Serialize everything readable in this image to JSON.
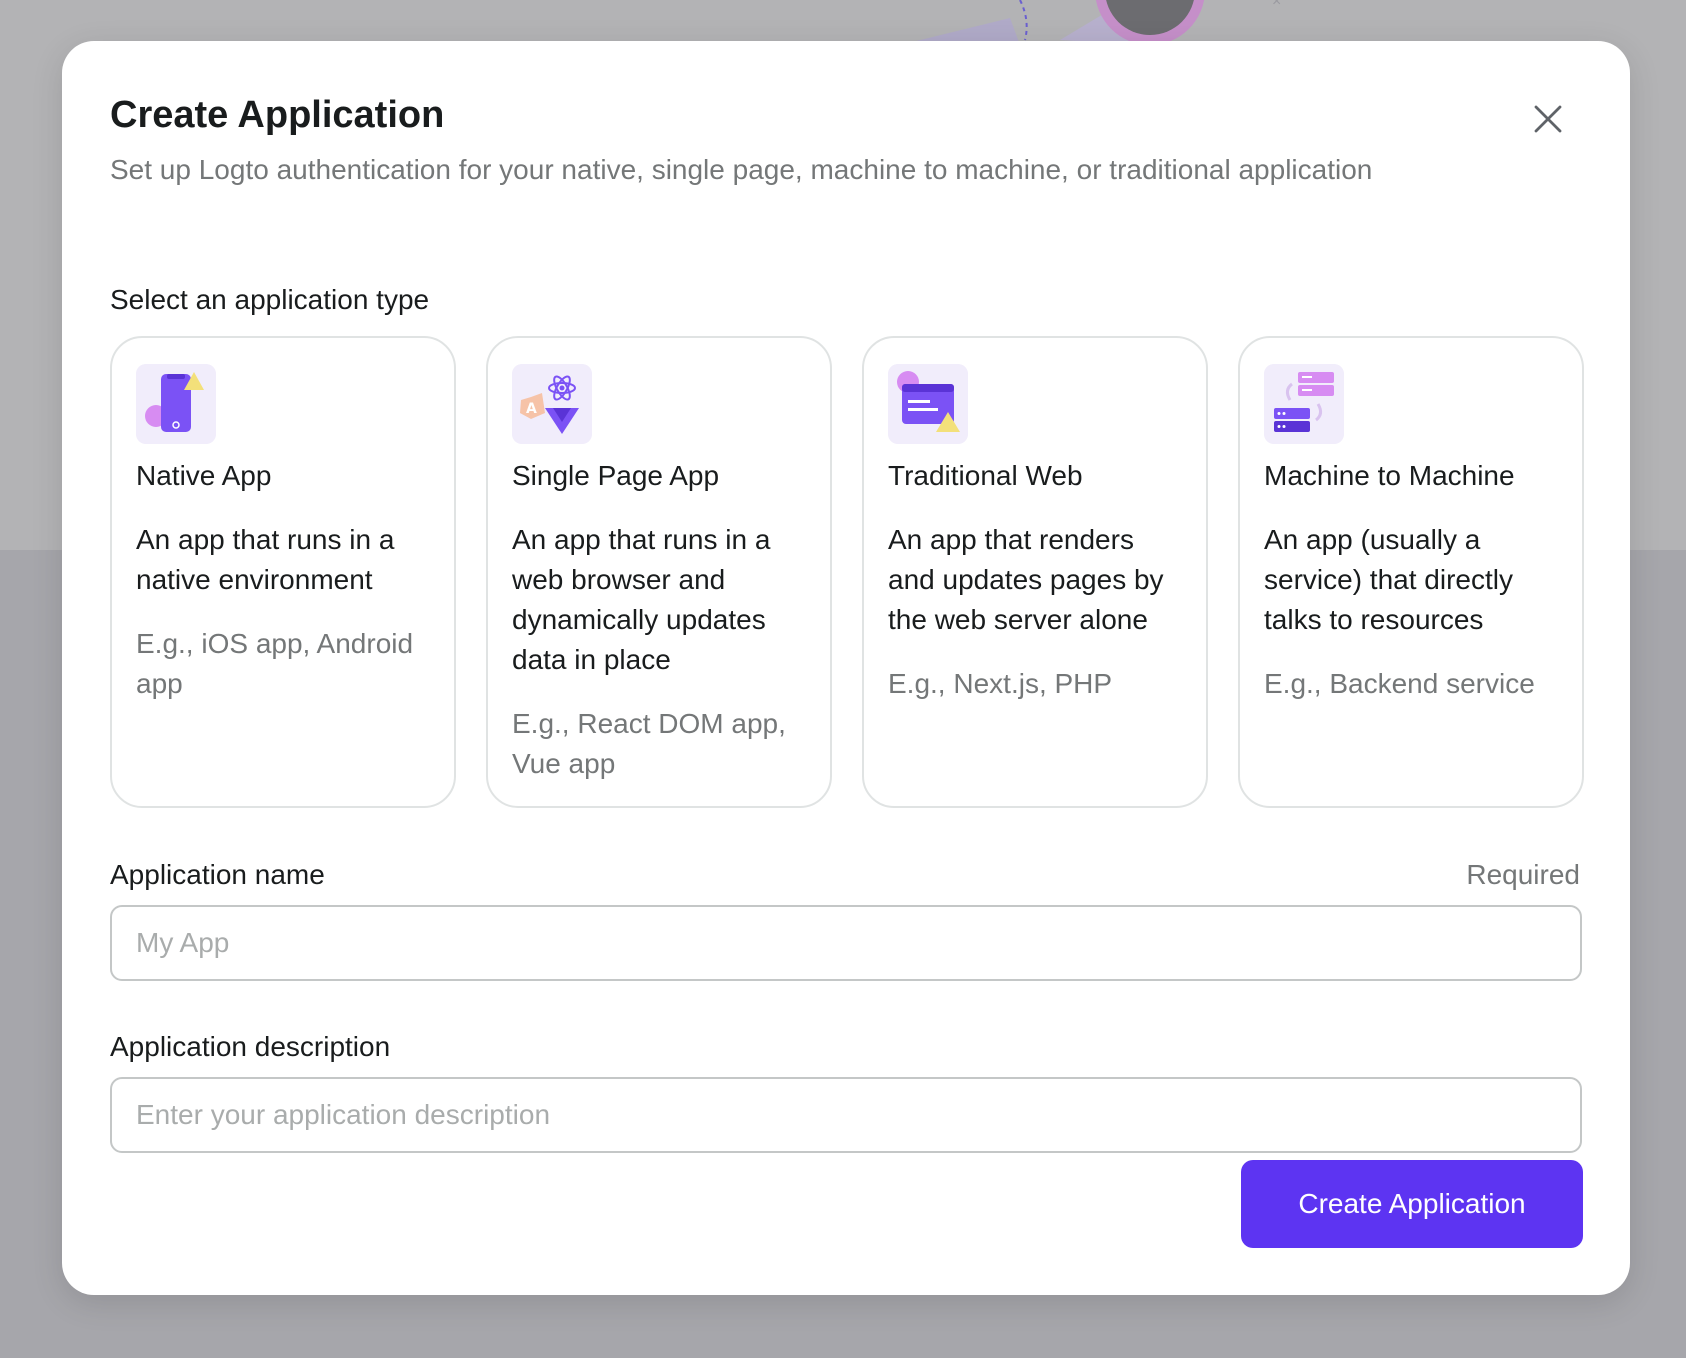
{
  "modal": {
    "title": "Create Application",
    "subtitle": "Set up Logto authentication for your native, single page, machine to machine, or traditional application",
    "close_icon": "close-icon"
  },
  "app_type": {
    "label": "Select an application type",
    "cards": [
      {
        "icon": "native-app-icon",
        "title": "Native App",
        "description": "An app that runs in a native environment",
        "example": "E.g., iOS app, Android app"
      },
      {
        "icon": "single-page-app-icon",
        "title": "Single Page App",
        "description": "An app that runs in a web browser and dynamically updates data in place",
        "example": "E.g., React DOM app, Vue app"
      },
      {
        "icon": "traditional-web-icon",
        "title": "Traditional Web",
        "description": "An app that renders and updates pages by the web server alone",
        "example": "E.g., Next.js, PHP"
      },
      {
        "icon": "machine-to-machine-icon",
        "title": "Machine to Machine",
        "description": "An app (usually a service) that directly talks to resources",
        "example": "E.g., Backend service"
      }
    ]
  },
  "name_field": {
    "label": "Application name",
    "required_text": "Required",
    "value": "",
    "placeholder": "My App"
  },
  "description_field": {
    "label": "Application description",
    "value": "",
    "placeholder": "Enter your application description"
  },
  "submit": {
    "label": "Create Application"
  },
  "colors": {
    "primary": "#5d34f2",
    "icon_bg": "#f1edfb",
    "accent_purple": "#7b52f5",
    "accent_pink": "#d78cf2",
    "accent_yellow": "#f3e07a"
  }
}
